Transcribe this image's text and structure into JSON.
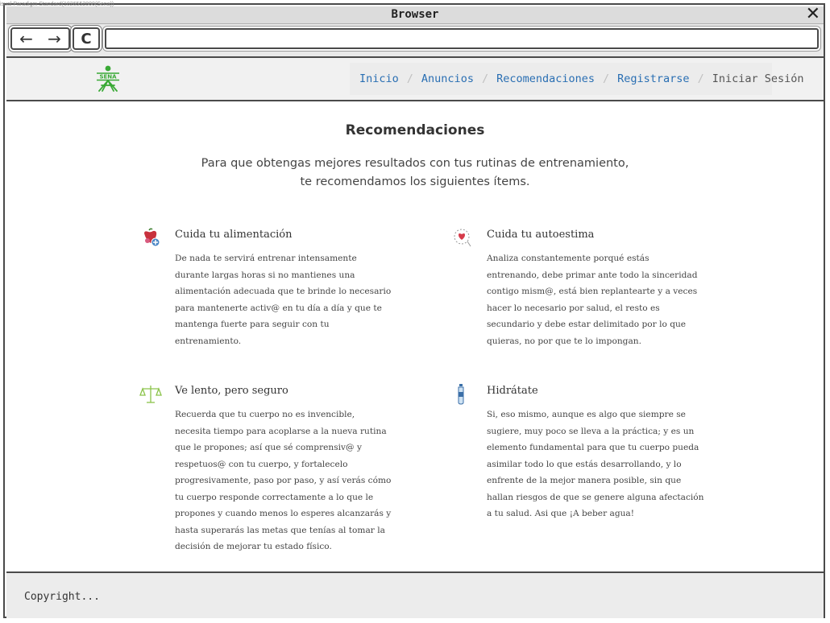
{
  "watermark": "isual Paradigm Standard(1026552000(Sena))",
  "browser": {
    "title": "Browser",
    "close_glyph": "✕",
    "back_glyph": "←",
    "forward_glyph": "→",
    "reload_glyph": "C",
    "url_value": ""
  },
  "header": {
    "logo_text": "SENA",
    "menu": [
      {
        "label": "Inicio",
        "active": false
      },
      {
        "label": "Anuncios",
        "active": false
      },
      {
        "label": "Recomendaciones",
        "active": false
      },
      {
        "label": "Registrarse",
        "active": false
      },
      {
        "label": "Iniciar Sesión",
        "active": true
      }
    ],
    "separator": "/"
  },
  "main": {
    "title": "Recomendaciones",
    "intro_line1": "Para que obtengas mejores resultados con tus rutinas de entrenamiento,",
    "intro_line2": "te recomendamos los siguientes ítems.",
    "cards": [
      {
        "icon": "apple-heart-icon",
        "title": "Cuida tu alimentación",
        "text": "De nada te servirá entrenar intensamente durante largas horas si no mantienes una alimentación adecuada que te brinde lo necesario para mantenerte activ@ en tu día a día y que te mantenga fuerte para seguir con tu entrenamiento."
      },
      {
        "icon": "head-heart-icon",
        "title": "Cuida tu autoestima",
        "text": "Analiza constantemente porqué estás entrenando, debe primar ante todo la sinceridad contigo mism@, está bien replantearte y a veces hacer lo necesario por salud, el resto es secundario y debe estar delimitado por lo que quieras, no por que te lo impongan."
      },
      {
        "icon": "balance-scale-icon",
        "title": "Ve lento, pero seguro",
        "text": "Recuerda que tu cuerpo no es invencible, necesita tiempo para acoplarse a la nueva rutina que le propones; así que sé comprensiv@ y respetuos@ con tu cuerpo, y fortalecelo progresivamente, paso por paso, y así verás cómo tu cuerpo responde correctamente a lo que le propones y cuando menos lo esperes alcanzarás y hasta superarás las metas que tenías al tomar la decisión de mejorar tu estado físico."
      },
      {
        "icon": "water-bottle-icon",
        "title": "Hidrátate",
        "text": "Si, eso mismo, aunque es algo que siempre se sugiere, muy poco se lleva a la práctica; y es un elemento fundamental para que tu cuerpo pueda asimilar todo lo que estás desarrollando, y lo enfrente de la mejor manera posible, sin que hallan riesgos de que se genere alguna afectación a tu salud. Asi que ¡A beber agua!"
      }
    ]
  },
  "footer": {
    "copyright": "Copyright..."
  },
  "colors": {
    "link": "#2a6fb3",
    "logo_green": "#39a935",
    "border": "#4a4a4a",
    "bar_bg": "#ececec"
  }
}
